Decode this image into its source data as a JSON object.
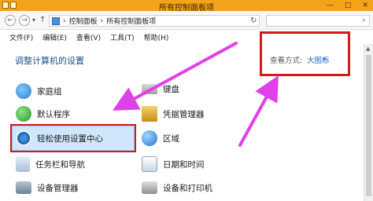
{
  "window": {
    "title": "所有控制面板项",
    "controls": [
      "—",
      "□",
      "✕"
    ]
  },
  "nav": {
    "back": "←",
    "forward": "→",
    "dropdown": "▾",
    "up": "↑",
    "breadcrumb": [
      "控制面板",
      "所有控制面板项"
    ],
    "separator": "›",
    "refresh": "↻",
    "search_glyph": "⌕"
  },
  "menu": [
    "文件(F)",
    "编辑(E)",
    "查看(V)",
    "工具(T)",
    "帮助(H)"
  ],
  "header": {
    "title": "调整计算机的设置",
    "view_by_label": "查看方式:",
    "view_by_value": "大图标",
    "view_by_caret": "▾"
  },
  "items": [
    {
      "label": "家庭组",
      "icon": "homegroup-icon"
    },
    {
      "label": "键盘",
      "icon": "keyboard-icon"
    },
    {
      "label": "默认程序",
      "icon": "default-programs-icon"
    },
    {
      "label": "凭据管理器",
      "icon": "credential-manager-icon"
    },
    {
      "label": "轻松使用设置中心",
      "icon": "ease-of-access-icon",
      "selected": true
    },
    {
      "label": "区域",
      "icon": "region-icon"
    },
    {
      "label": "任务栏和导航",
      "icon": "taskbar-icon"
    },
    {
      "label": "日期和时间",
      "icon": "date-time-icon"
    },
    {
      "label": "设备管理器",
      "icon": "device-manager-icon"
    },
    {
      "label": "设备和打印机",
      "icon": "devices-printers-icon"
    }
  ],
  "colors": {
    "titlebar": "#f3a31a",
    "annotation_red": "#d3191a",
    "annotation_arrow": "#e040e8",
    "link_blue": "#1f6bd1",
    "selection": "#cfe6fb"
  }
}
